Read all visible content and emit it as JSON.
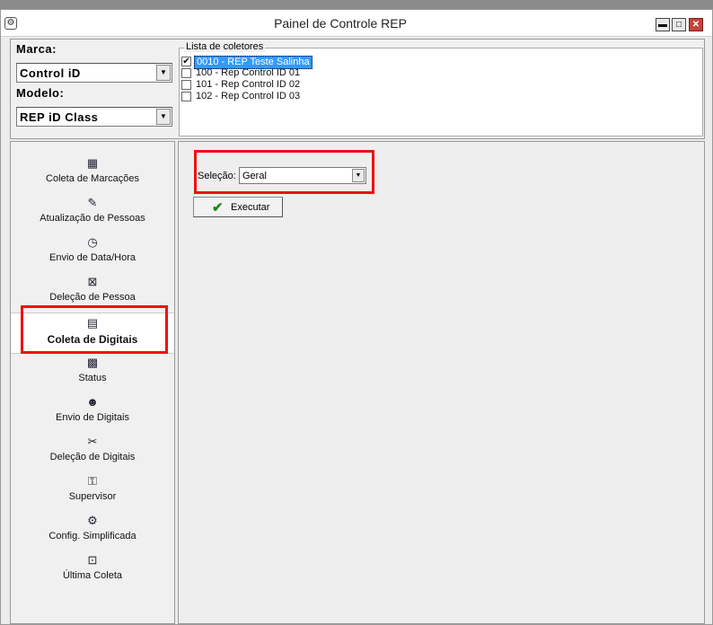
{
  "window": {
    "title": "Painel de Controle REP",
    "icons": {
      "app": "gear-icon",
      "minimize": "minimize-icon",
      "maximize": "maximize-icon",
      "close": "close-icon"
    }
  },
  "top": {
    "marca_label": "Marca:",
    "marca_value": "Control iD",
    "modelo_label": "Modelo:",
    "modelo_value": "REP iD Class",
    "list_legend": "Lista de coletores",
    "coletores": [
      {
        "text": "0010 - REP Teste Salinha",
        "checked": true,
        "selected": true
      },
      {
        "text": "100 - Rep Control ID 01",
        "checked": false,
        "selected": false
      },
      {
        "text": "101 - Rep Control ID 02",
        "checked": false,
        "selected": false
      },
      {
        "text": "102 - Rep Control ID 03",
        "checked": false,
        "selected": false
      }
    ]
  },
  "nav": {
    "items": [
      {
        "label": "Coleta de Marcações",
        "icon": "card-icon"
      },
      {
        "label": "Atualização de Pessoas",
        "icon": "person-edit-icon"
      },
      {
        "label": "Envio de Data/Hora",
        "icon": "clock-icon"
      },
      {
        "label": "Deleção de Pessoa",
        "icon": "person-delete-icon"
      },
      {
        "label": "Coleta de Digitais",
        "icon": "fingerprint-collect-icon",
        "active": true
      },
      {
        "label": "Status",
        "icon": "status-icon"
      },
      {
        "label": "Envio de Digitais",
        "icon": "fingerprint-send-icon"
      },
      {
        "label": "Deleção de Digitais",
        "icon": "scissors-icon"
      },
      {
        "label": "Supervisor",
        "icon": "supervisor-icon"
      },
      {
        "label": "Config. Simplificada",
        "icon": "config-icon"
      },
      {
        "label": "Última Coleta",
        "icon": "last-collect-icon"
      }
    ]
  },
  "main": {
    "selecao_label": "Seleção:",
    "selecao_value": "Geral",
    "execute_label": "Executar"
  },
  "colors": {
    "highlight": "#ee1111",
    "selection": "#3399ff",
    "check": "#1a8a1a"
  }
}
